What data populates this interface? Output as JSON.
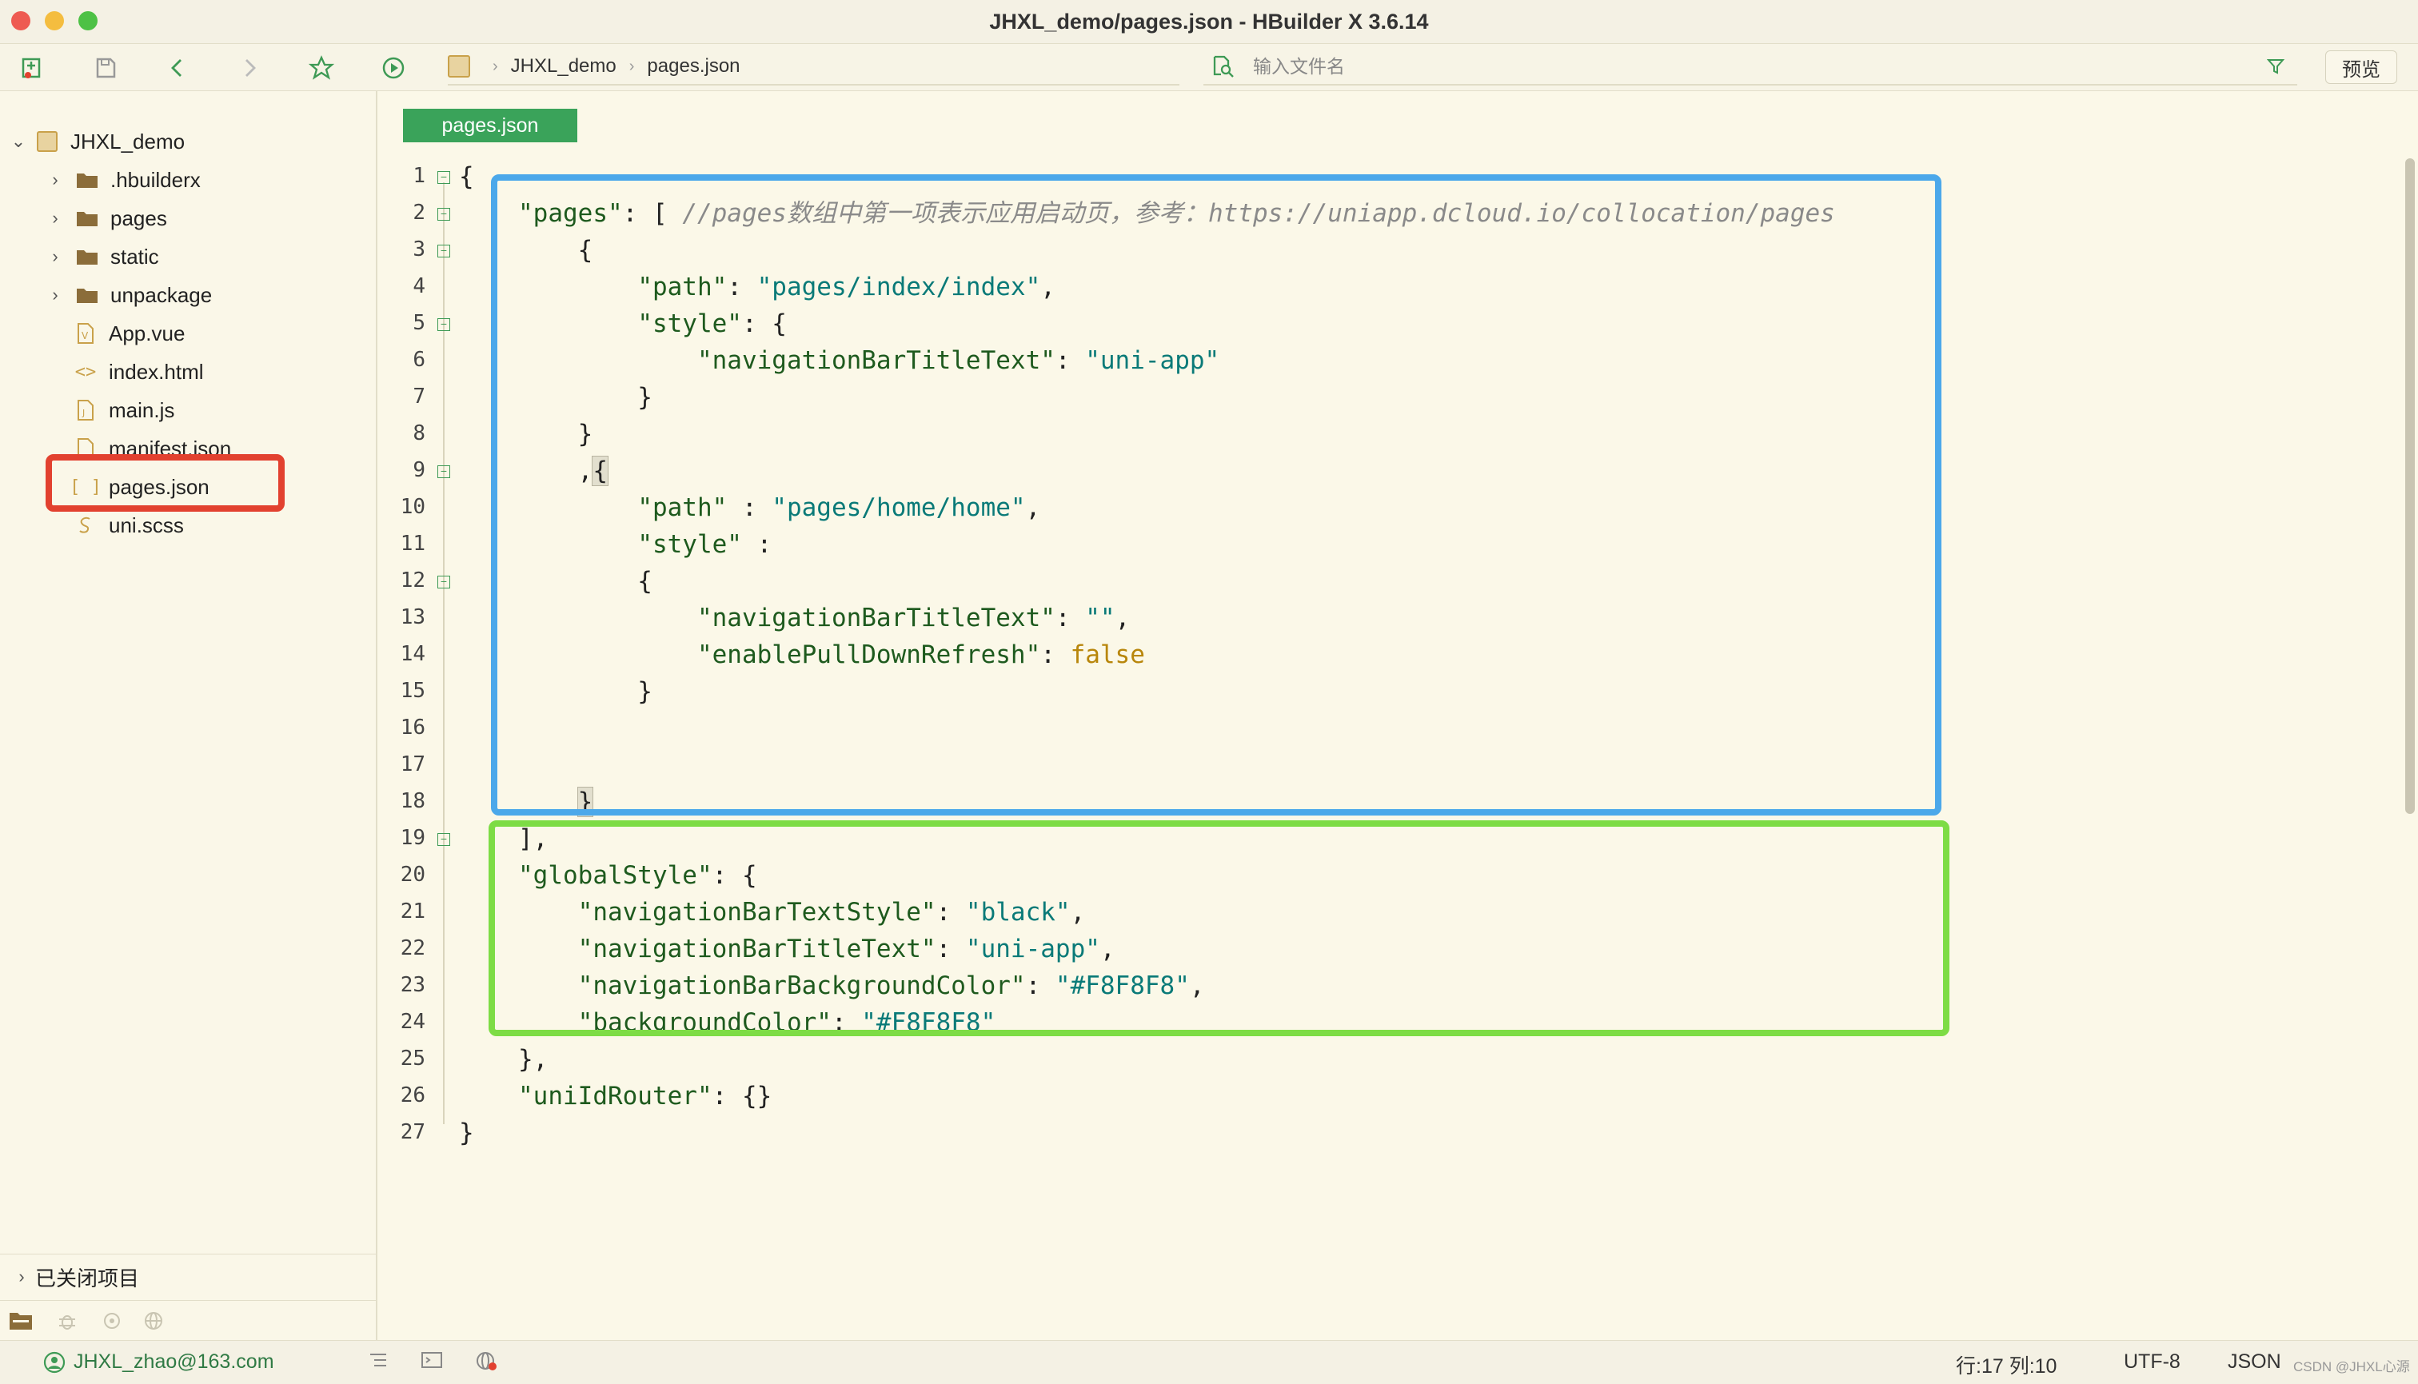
{
  "window": {
    "title": "JHXL_demo/pages.json - HBuilder X 3.6.14"
  },
  "toolbar": {
    "icons": [
      "new-file-icon",
      "save-icon",
      "back-icon",
      "forward-icon",
      "star-icon",
      "run-icon"
    ],
    "breadcrumb": [
      "JHXL_demo",
      "pages.json"
    ],
    "search_placeholder": "输入文件名",
    "preview_label": "预览"
  },
  "sidebar": {
    "project": "JHXL_demo",
    "items": [
      {
        "label": ".hbuilderx",
        "type": "folder"
      },
      {
        "label": "pages",
        "type": "folder"
      },
      {
        "label": "static",
        "type": "folder"
      },
      {
        "label": "unpackage",
        "type": "folder"
      },
      {
        "label": "App.vue",
        "type": "vue"
      },
      {
        "label": "index.html",
        "type": "html"
      },
      {
        "label": "main.js",
        "type": "js"
      },
      {
        "label": "manifest.json",
        "type": "json"
      },
      {
        "label": "pages.json",
        "type": "json-selected"
      },
      {
        "label": "uni.scss",
        "type": "scss"
      }
    ],
    "closed_projects": "已关闭项目"
  },
  "editor": {
    "tab": "pages.json",
    "lines": [
      "1",
      "2",
      "3",
      "4",
      "5",
      "6",
      "7",
      "8",
      "9",
      "10",
      "11",
      "12",
      "13",
      "14",
      "15",
      "16",
      "17",
      "18",
      "19",
      "20",
      "21",
      "22",
      "23",
      "24",
      "25",
      "26",
      "27"
    ],
    "code": {
      "l1": "{",
      "l2_key": "\"pages\"",
      "l2_rest": ": [ ",
      "l2_comment": "//pages数组中第一项表示应用启动页，参考：https://uniapp.dcloud.io/collocation/pages",
      "l3": "    {",
      "l4_key": "\"path\"",
      "l4_val": "\"pages/index/index\"",
      "l5_key": "\"style\"",
      "l5_rest": ": {",
      "l6_key": "\"navigationBarTitleText\"",
      "l6_val": "\"uni-app\"",
      "l7": "        }",
      "l8": "    }",
      "l9_pre": "    ,",
      "l9_brace": "{",
      "l10_key": "\"path\"",
      "l10_val": "\"pages/home/home\"",
      "l11_key": "\"style\"",
      "l11_rest": " :",
      "l12": "        {",
      "l13_key": "\"navigationBarTitleText\"",
      "l13_val": "\"\"",
      "l14_key": "\"enablePullDownRefresh\"",
      "l14_val": "false",
      "l15": "        }",
      "l17_brace": "}",
      "l18": "],",
      "l19_key": "\"globalStyle\"",
      "l19_rest": ": {",
      "l20_key": "\"navigationBarTextStyle\"",
      "l20_val": "\"black\"",
      "l21_key": "\"navigationBarTitleText\"",
      "l21_val": "\"uni-app\"",
      "l22_key": "\"navigationBarBackgroundColor\"",
      "l22_val": "\"#F8F8F8\"",
      "l23_key": "\"backgroundColor\"",
      "l23_val": "\"#F8F8F8\"",
      "l24": "},",
      "l25_key": "\"uniIdRouter\"",
      "l25_rest": ": {}",
      "l26": "}"
    }
  },
  "statusbar": {
    "user": "JHXL_zhao@163.com",
    "position": "行:17  列:10",
    "encoding": "UTF-8",
    "language": "JSON",
    "watermark": "CSDN @JHXL心源"
  },
  "colors": {
    "highlight_red": "#e2412f",
    "highlight_blue": "#4ba8ea",
    "highlight_green": "#7ddc45",
    "tab_green": "#3aa35a",
    "background": "#fbf8e8"
  }
}
